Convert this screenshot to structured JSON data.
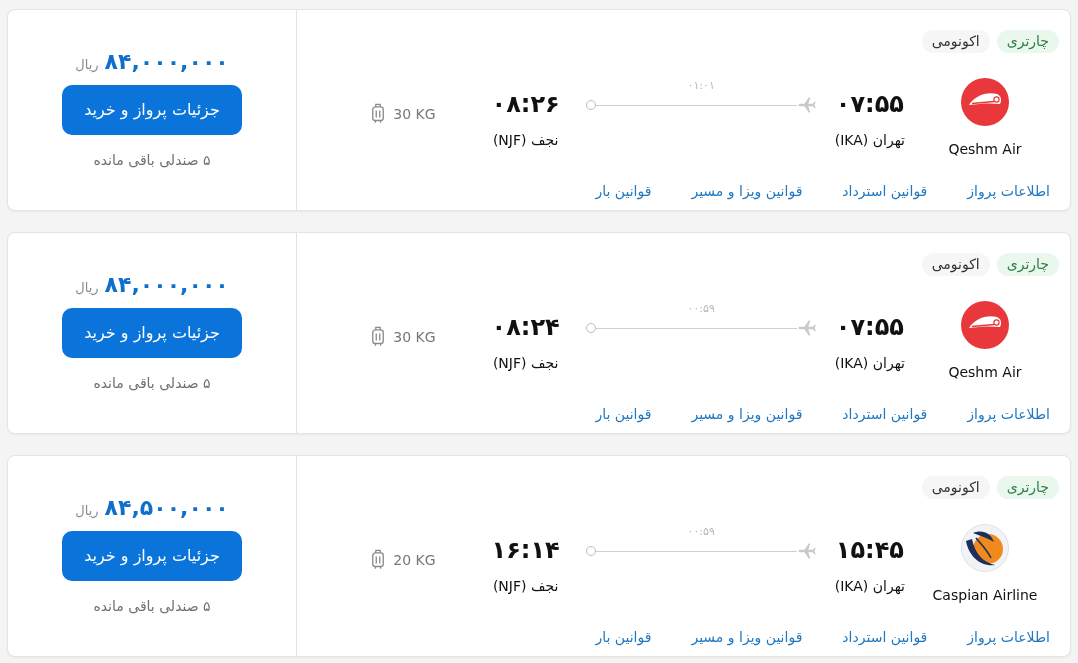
{
  "flights": [
    {
      "tags": [
        {
          "label": "چارتری",
          "kind": "charter"
        },
        {
          "label": "اکونومی",
          "kind": "cabin"
        }
      ],
      "airline": {
        "name": "Qeshm Air",
        "kind": "swoosh"
      },
      "departure": {
        "time": "۰۷:۵۵",
        "city": "تهران (IKA)"
      },
      "duration": "۰۱:۰۱",
      "arrival": {
        "time": "۰۸:۲۶",
        "city": "نجف (NJF)"
      },
      "baggage": "30 KG",
      "links": [
        "اطلاعات پرواز",
        "قوانین استرداد",
        "قوانین ویزا و مسیر",
        "قوانین بار"
      ],
      "price": "۸۴,۰۰۰,۰۰۰",
      "currency": "ریال",
      "button": "جزئیات پرواز و خرید",
      "seats_left": "۵ صندلی باقی مانده"
    },
    {
      "tags": [
        {
          "label": "چارتری",
          "kind": "charter"
        },
        {
          "label": "اکونومی",
          "kind": "cabin"
        }
      ],
      "airline": {
        "name": "Qeshm Air",
        "kind": "swoosh"
      },
      "departure": {
        "time": "۰۷:۵۵",
        "city": "تهران (IKA)"
      },
      "duration": "۰۰:۵۹",
      "arrival": {
        "time": "۰۸:۲۴",
        "city": "نجف (NJF)"
      },
      "baggage": "30 KG",
      "links": [
        "اطلاعات پرواز",
        "قوانین استرداد",
        "قوانین ویزا و مسیر",
        "قوانین بار"
      ],
      "price": "۸۴,۰۰۰,۰۰۰",
      "currency": "ریال",
      "button": "جزئیات پرواز و خرید",
      "seats_left": "۵ صندلی باقی مانده"
    },
    {
      "tags": [
        {
          "label": "چارتری",
          "kind": "charter"
        },
        {
          "label": "اکونومی",
          "kind": "cabin"
        }
      ],
      "airline": {
        "name": "Caspian Airline",
        "kind": "bird"
      },
      "departure": {
        "time": "۱۵:۴۵",
        "city": "تهران (IKA)"
      },
      "duration": "۰۰:۵۹",
      "arrival": {
        "time": "۱۶:۱۴",
        "city": "نجف (NJF)"
      },
      "baggage": "20 KG",
      "links": [
        "اطلاعات پرواز",
        "قوانین استرداد",
        "قوانین ویزا و مسیر",
        "قوانین بار"
      ],
      "price": "۸۴,۵۰۰,۰۰۰",
      "currency": "ریال",
      "button": "جزئیات پرواز و خرید",
      "seats_left": "۵ صندلی باقی مانده"
    }
  ]
}
